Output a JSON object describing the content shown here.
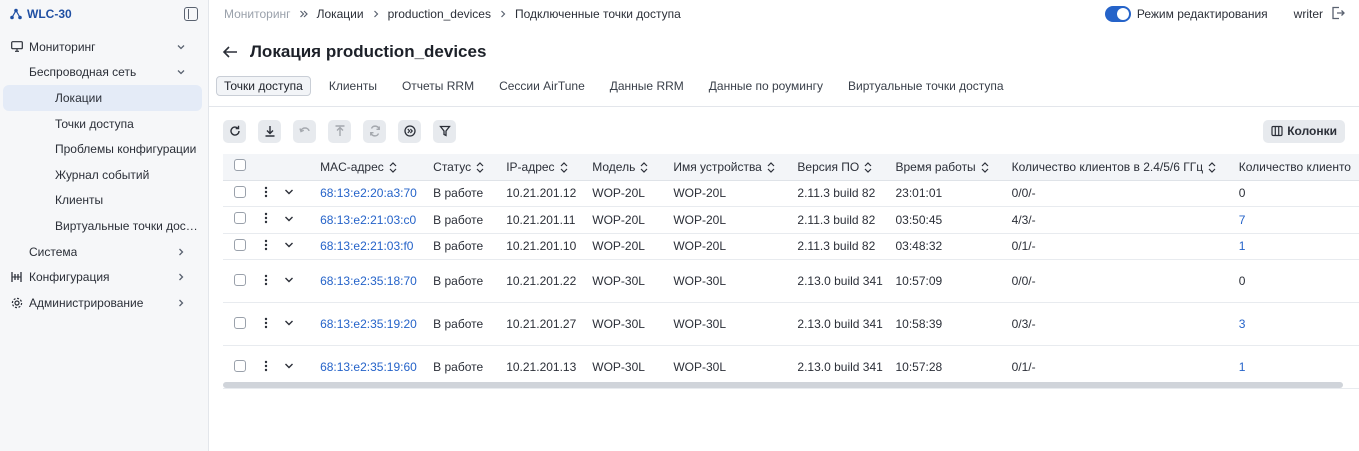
{
  "app": {
    "title": "WLC-30"
  },
  "sidebar": {
    "items": [
      {
        "label": "Мониторинг",
        "icon": "monitor-icon"
      },
      {
        "label": "Беспроводная сеть"
      },
      {
        "label": "Локации"
      },
      {
        "label": "Точки доступа"
      },
      {
        "label": "Проблемы конфигурации"
      },
      {
        "label": "Журнал событий"
      },
      {
        "label": "Клиенты"
      },
      {
        "label": "Виртуальные точки доступа"
      },
      {
        "label": "Система"
      },
      {
        "label": "Конфигурация",
        "icon": "config-icon"
      },
      {
        "label": "Администрирование",
        "icon": "gear-icon"
      }
    ]
  },
  "breadcrumb": {
    "items": [
      "Мониторинг",
      "Локации",
      "production_devices",
      "Подключенные точки доступа"
    ]
  },
  "header": {
    "edit_mode_label": "Режим редактирования",
    "edit_mode_on": true,
    "user": "writer"
  },
  "page": {
    "title": "Локация production_devices"
  },
  "tabs": [
    "Точки доступа",
    "Клиенты",
    "Отчеты RRM",
    "Сессии AirTune",
    "Данные RRM",
    "Данные по роумингу",
    "Виртуальные точки доступа"
  ],
  "toolbar": {
    "columns_label": "Колонки"
  },
  "table": {
    "columns": [
      "MAC-адрес",
      "Статус",
      "IP-адрес",
      "Модель",
      "Имя устройства",
      "Версия ПО",
      "Время работы",
      "Количество клиентов в 2.4/5/6 ГГц",
      "Количество клиенто"
    ],
    "rows": [
      {
        "mac": "68:13:e2:20:a3:70",
        "status": "В работе",
        "ip": "10.21.201.12",
        "model": "WOP-20L",
        "name": "WOP-20L",
        "fw": "2.11.3 build 82",
        "uptime": "23:01:01",
        "clients_bands": "0/0/-",
        "clients": "0"
      },
      {
        "mac": "68:13:e2:21:03:c0",
        "status": "В работе",
        "ip": "10.21.201.11",
        "model": "WOP-20L",
        "name": "WOP-20L",
        "fw": "2.11.3 build 82",
        "uptime": "03:50:45",
        "clients_bands": "4/3/-",
        "clients": "7"
      },
      {
        "mac": "68:13:e2:21:03:f0",
        "status": "В работе",
        "ip": "10.21.201.10",
        "model": "WOP-20L",
        "name": "WOP-20L",
        "fw": "2.11.3 build 82",
        "uptime": "03:48:32",
        "clients_bands": "0/1/-",
        "clients": "1"
      },
      {
        "mac": "68:13:e2:35:18:70",
        "status": "В работе",
        "ip": "10.21.201.22",
        "model": "WOP-30L",
        "name": "WOP-30L",
        "fw": "2.13.0 build 341",
        "uptime": "10:57:09",
        "clients_bands": "0/0/-",
        "clients": "0"
      },
      {
        "mac": "68:13:e2:35:19:20",
        "status": "В работе",
        "ip": "10.21.201.27",
        "model": "WOP-30L",
        "name": "WOP-30L",
        "fw": "2.13.0 build 341",
        "uptime": "10:58:39",
        "clients_bands": "0/3/-",
        "clients": "3"
      },
      {
        "mac": "68:13:e2:35:19:60",
        "status": "В работе",
        "ip": "10.21.201.13",
        "model": "WOP-30L",
        "name": "WOP-30L",
        "fw": "2.13.0 build 341",
        "uptime": "10:57:28",
        "clients_bands": "0/1/-",
        "clients": "1"
      }
    ]
  },
  "colors": {
    "accent": "#2563c9",
    "sidebar_bg": "#f6f7f9",
    "active_item_bg": "#e4ebf7"
  }
}
